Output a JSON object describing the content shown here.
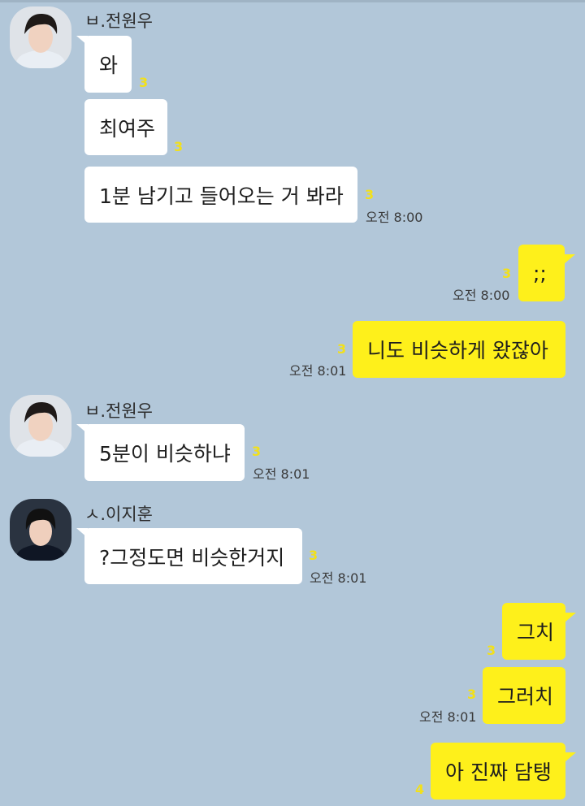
{
  "colors": {
    "background": "#b2c7d9",
    "incoming_bubble": "#ffffff",
    "outgoing_bubble": "#fef01b",
    "unread_count": "#f2e01a"
  },
  "senders": {
    "wonwoo": "ㅂ.전원우",
    "jihoon": "ㅅ.이지훈"
  },
  "messages": [
    {
      "text": "와",
      "unread": "3",
      "time": ""
    },
    {
      "text": "최여주",
      "unread": "3",
      "time": ""
    },
    {
      "text": "1분 남기고 들어오는 거 봐라",
      "unread": "3",
      "time": "오전 8:00"
    },
    {
      "text": ";;",
      "unread": "3",
      "time": "오전 8:00"
    },
    {
      "text": "니도 비슷하게 왔잖아",
      "unread": "3",
      "time": "오전 8:01"
    },
    {
      "text": "5분이 비슷하냐",
      "unread": "3",
      "time": "오전 8:01"
    },
    {
      "text": "?그정도면 비슷한거지",
      "unread": "3",
      "time": "오전 8:01"
    },
    {
      "text": "그치",
      "unread": "3",
      "time": ""
    },
    {
      "text": "그러치",
      "unread": "3",
      "time": "오전 8:01"
    },
    {
      "text": "아 진짜 담탱",
      "unread": "4",
      "time": ""
    }
  ]
}
